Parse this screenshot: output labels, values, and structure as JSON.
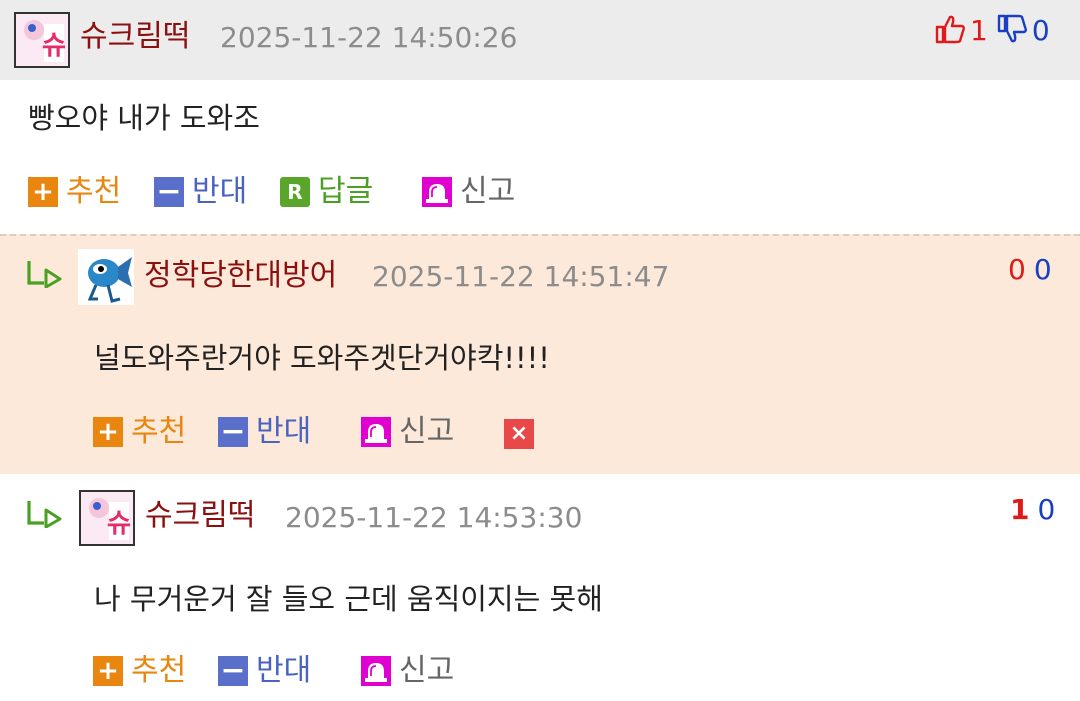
{
  "comments": [
    {
      "author": "슈크림떡",
      "timestamp": "2025-11-22 14:50:26",
      "text": "빵오야 내가 도와조",
      "upvotes": "1",
      "downvotes": "0",
      "actions": {
        "recommend": "추천",
        "oppose": "반대",
        "reply": "답글",
        "report": "신고"
      }
    },
    {
      "author": "정학당한대방어",
      "timestamp": "2025-11-22 14:51:47",
      "text": "널도와주란거야 도와주겟단거야칵!!!!",
      "upvotes": "0",
      "downvotes": "0",
      "actions": {
        "recommend": "추천",
        "oppose": "반대",
        "report": "신고"
      }
    },
    {
      "author": "슈크림떡",
      "timestamp": "2025-11-22 14:53:30",
      "text": "나 무거운거 잘 들오 근데 움직이지는 못해",
      "upvotes": "1",
      "downvotes": "0",
      "actions": {
        "recommend": "추천",
        "oppose": "반대",
        "report": "신고"
      }
    }
  ],
  "icons": {
    "plus": "+",
    "minus": "−",
    "reply": "R",
    "delete": "×"
  },
  "colors": {
    "nickname": "#8b1010",
    "recommend": "#e8860f",
    "oppose": "#5a6fc9",
    "reply": "#5aa62a",
    "report": "#e000d0",
    "delete": "#e84848",
    "reply_background": "#fce9d9"
  }
}
